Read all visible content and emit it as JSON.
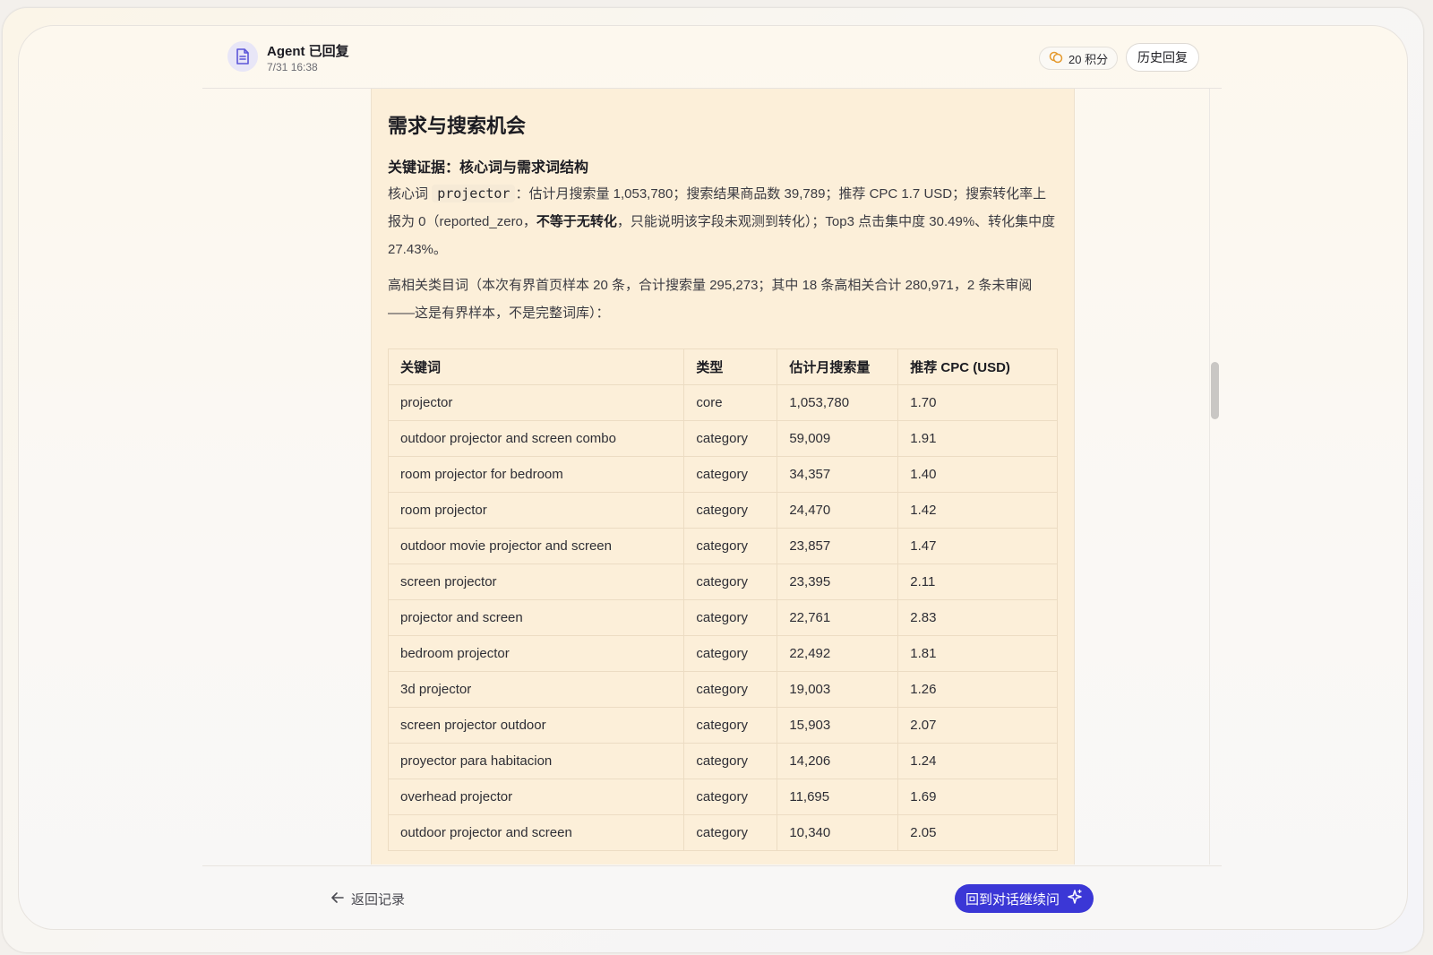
{
  "header": {
    "title": "Agent 已回复",
    "time": "7/31 16:38",
    "points": "20 积分",
    "history_label": "历史回复"
  },
  "report": {
    "section_title": "需求与搜索机会",
    "sub_title": "关键证据：核心词与需求词结构",
    "p1": {
      "prefix": "核心词",
      "keyword": "projector",
      "text_a": "：估计月搜索量 1,053,780；搜索结果商品数 39,789；推荐 CPC 1.7 USD；搜索转化率上报为 0（reported_zero，",
      "bold": "不等于无转化",
      "text_b": "，只能说明该字段未观测到转化）；Top3 点击集中度 30.49%、转化集中度 27.43%。"
    },
    "p2": "高相关类目词（本次有界首页样本 20 条，合计搜索量 295,273；其中 18 条高相关合计 280,971，2 条未审阅——这是有界样本，不是完整词库）：",
    "table": {
      "headers": [
        "关键词",
        "类型",
        "估计月搜索量",
        "推荐 CPC (USD)"
      ],
      "rows": [
        [
          "projector",
          "core",
          "1,053,780",
          "1.70"
        ],
        [
          "outdoor projector and screen combo",
          "category",
          "59,009",
          "1.91"
        ],
        [
          "room projector for bedroom",
          "category",
          "34,357",
          "1.40"
        ],
        [
          "room projector",
          "category",
          "24,470",
          "1.42"
        ],
        [
          "outdoor movie projector and screen",
          "category",
          "23,857",
          "1.47"
        ],
        [
          "screen projector",
          "category",
          "23,395",
          "2.11"
        ],
        [
          "projector and screen",
          "category",
          "22,761",
          "2.83"
        ],
        [
          "bedroom projector",
          "category",
          "22,492",
          "1.81"
        ],
        [
          "3d projector",
          "category",
          "19,003",
          "1.26"
        ],
        [
          "screen projector outdoor",
          "category",
          "15,903",
          "2.07"
        ],
        [
          "proyector para habitacion",
          "category",
          "14,206",
          "1.24"
        ],
        [
          "overhead projector",
          "category",
          "11,695",
          "1.69"
        ],
        [
          "outdoor projector and screen",
          "category",
          "10,340",
          "2.05"
        ]
      ]
    }
  },
  "footer": {
    "back_label": "返回记录",
    "continue_label": "回到对话继续问"
  },
  "colors": {
    "accent": "#3b37d6",
    "card_bg": "#fcefd9",
    "badge_bg": "#e8e6f7",
    "coin": "#e59a2e"
  }
}
